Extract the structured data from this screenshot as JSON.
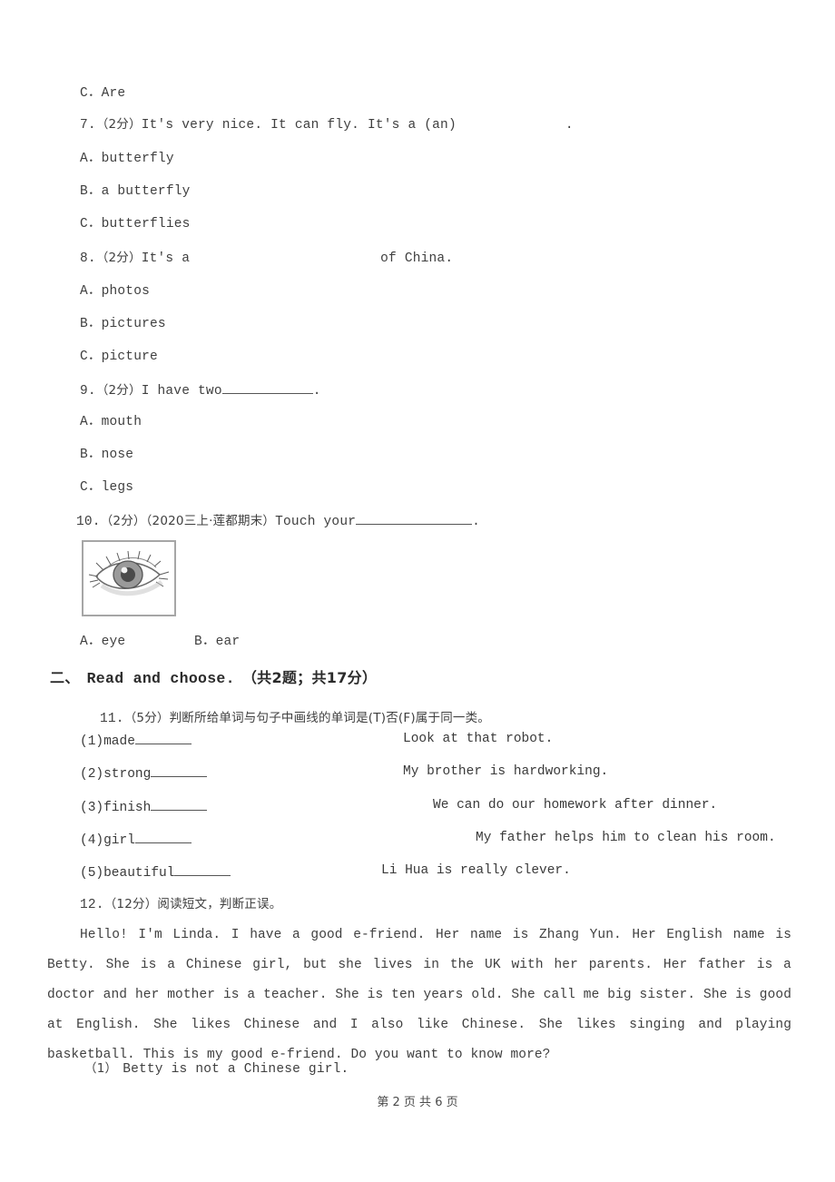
{
  "document": {
    "type": "english-exam-paper",
    "page_footer": "第 2 页 共 6 页"
  },
  "questions": [
    {
      "id": "q6-option-c",
      "label": "C．Are"
    },
    {
      "number": "7.",
      "score": "（2分）",
      "stem_before": "It's very nice. It can fly. It's a (an)",
      "stem_after": ".",
      "options": [
        "A．butterfly",
        "B．a butterfly",
        "C．butterflies"
      ]
    },
    {
      "number": "8.",
      "score": "（2分）",
      "stem_before": "It's a",
      "stem_after": "of China.",
      "options": [
        "A．photos",
        "B．pictures",
        "C．picture"
      ]
    },
    {
      "number": "9.",
      "score": "（2分）",
      "stem_before": "I have two",
      "stem_after": ".",
      "options": [
        "A．mouth",
        "B．nose",
        "C．legs"
      ]
    },
    {
      "number": "10.",
      "score": "（2分）",
      "source": "（2020三上·莲都期末）",
      "stem_before": "Touch your",
      "stem_after": ".",
      "image_alt": "eye",
      "options_inline": [
        "A．eye",
        "B．ear"
      ]
    }
  ],
  "section": {
    "index": "二、",
    "title": "Read and choose.",
    "meta": "（共2题；共17分）"
  },
  "question11": {
    "number": "11.",
    "score": "（5分）",
    "prompt": "判断所给单词与句子中画线的单词是(T)否(F)属于同一类。",
    "items": [
      {
        "label": "(1)made",
        "sentence": "Look at that robot."
      },
      {
        "label": "(2)strong",
        "sentence": "My brother is hardworking."
      },
      {
        "label": "(3)finish",
        "sentence": "We can do our homework after dinner."
      },
      {
        "label": "(4)girl",
        "sentence": "My father helps him to clean his room."
      },
      {
        "label": "(5)beautiful",
        "sentence": "Li Hua is really clever."
      }
    ]
  },
  "question12": {
    "number": "12.",
    "score": "（12分）",
    "prompt": "阅读短文，判断正误。",
    "passage": "Hello! I'm Linda. I have a good e-friend. Her name is Zhang Yun. Her English name is Betty. She is a Chinese girl, but she lives in the UK with her parents. Her father is a doctor and her mother is a teacher. She is ten years old. She call me big sister. She is good at English. She likes Chinese and I also like Chinese. She likes singing and playing basketball. This is my good e-friend. Do you want to know more?",
    "sub_items": [
      {
        "label": "（1）",
        "text": "Betty is not a Chinese girl."
      }
    ]
  },
  "colors": {
    "text": "#3f3f3f",
    "heading": "#2b2b2b",
    "rule": "#555555",
    "image_border": "#a6a6a6",
    "background": "#ffffff"
  }
}
